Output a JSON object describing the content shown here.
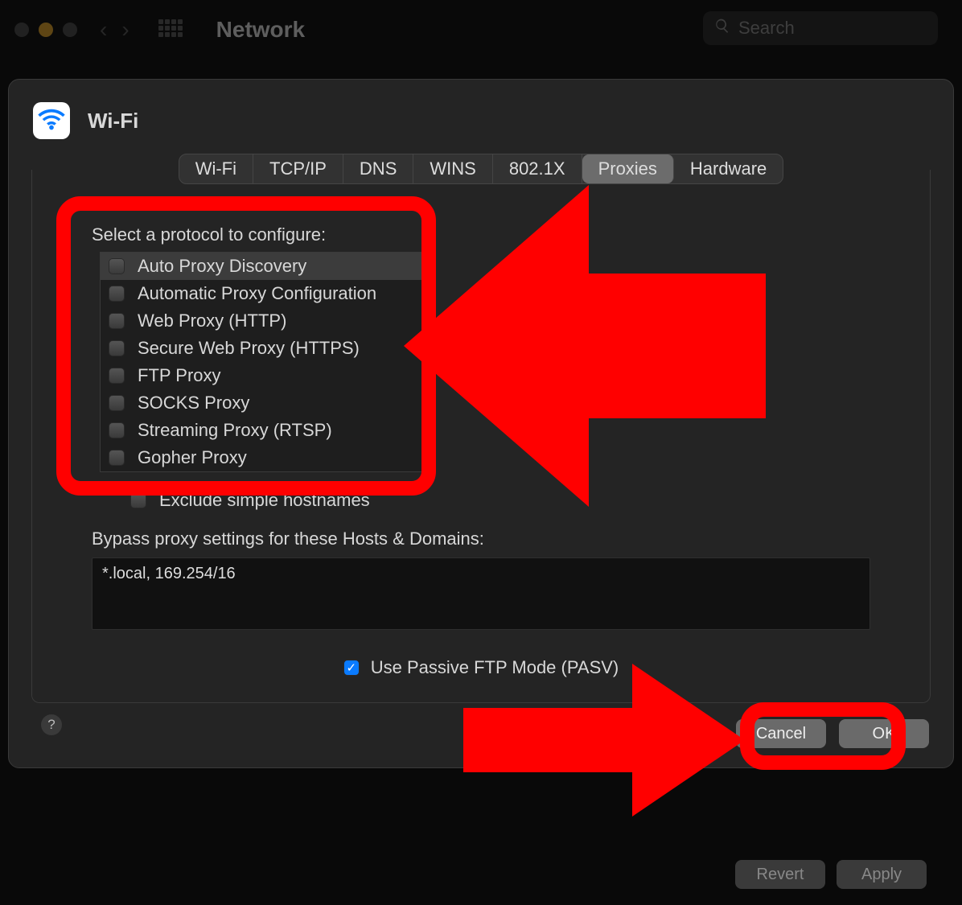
{
  "titlebar": {
    "title": "Network",
    "search_placeholder": "Search"
  },
  "sheet": {
    "service": "Wi-Fi",
    "tabs": [
      "Wi-Fi",
      "TCP/IP",
      "DNS",
      "WINS",
      "802.1X",
      "Proxies",
      "Hardware"
    ],
    "active_tab": "Proxies",
    "protocol_label": "Select a protocol to configure:",
    "protocols": [
      "Auto Proxy Discovery",
      "Automatic Proxy Configuration",
      "Web Proxy (HTTP)",
      "Secure Web Proxy (HTTPS)",
      "FTP Proxy",
      "SOCKS Proxy",
      "Streaming Proxy (RTSP)",
      "Gopher Proxy"
    ],
    "selected_protocol_index": 0,
    "exclude_label": "Exclude simple hostnames",
    "bypass_label": "Bypass proxy settings for these Hosts & Domains:",
    "bypass_value": "*.local, 169.254/16",
    "pasv_label": "Use Passive FTP Mode (PASV)",
    "pasv_checked": true,
    "cancel": "Cancel",
    "ok": "OK"
  },
  "bottom": {
    "revert": "Revert",
    "apply": "Apply"
  }
}
